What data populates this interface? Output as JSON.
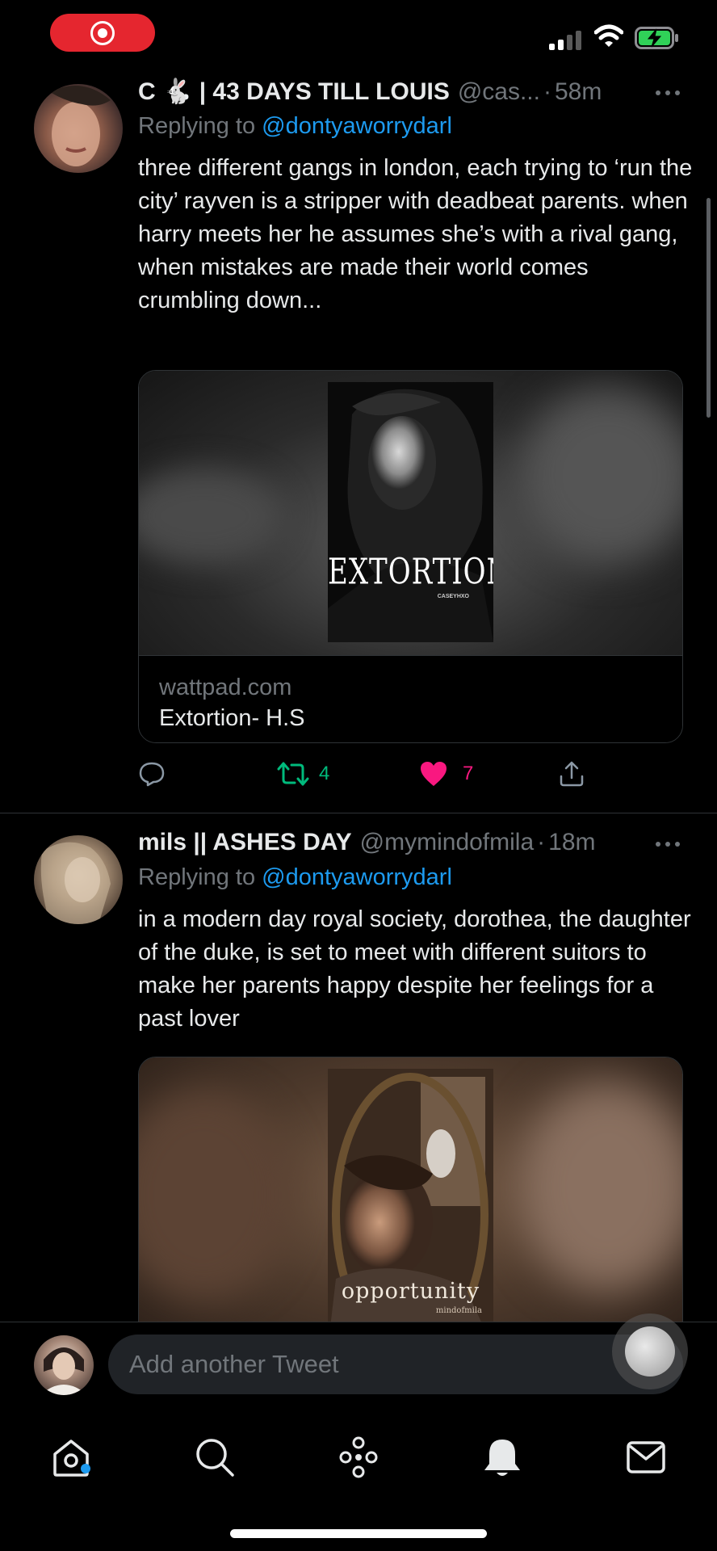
{
  "status_bar": {
    "recording_indicator": "screen-record-icon",
    "signal_icon": "cellular-signal-icon",
    "wifi_icon": "wifi-icon",
    "battery_icon": "battery-charging-icon",
    "battery_color": "#30d158",
    "record_color": "#e5262f"
  },
  "tweets": [
    {
      "display_name": "C 🐇 | 43 DAYS TILL LOUIS",
      "handle": "@cas...",
      "separator": "·",
      "time": "58m",
      "replying_prefix": "Replying to ",
      "replying_to": "@dontyaworrydarl",
      "text": "three different gangs in london, each trying to ‘run the city’ rayven is a stripper with deadbeat parents. when harry meets her he assumes she’s with a rival gang, when mistakes are made their world comes crumbling down...",
      "card": {
        "cover_title": "EXTORTION",
        "cover_author": "CASEYHXO",
        "domain": "wattpad.com",
        "title": "Extortion- H.S"
      },
      "actions": {
        "retweet_count": "4",
        "like_count": "7",
        "retweet_color": "#00ba7c",
        "like_color": "#f91880"
      }
    },
    {
      "display_name": "mils || ASHES DAY",
      "handle": "@mymindofmila",
      "separator": "·",
      "time": "18m",
      "replying_prefix": "Replying to ",
      "replying_to": "@dontyaworrydarl",
      "text": "in a modern day royal society, dorothea, the daughter of the duke, is set to meet with different suitors to make her parents happy despite her feelings for a past lover",
      "card": {
        "cover_title": "opportunity",
        "cover_author": "mindofmila"
      }
    }
  ],
  "compose": {
    "placeholder": "Add another Tweet"
  },
  "tabbar": {
    "items": [
      {
        "name": "home-icon"
      },
      {
        "name": "search-icon"
      },
      {
        "name": "spaces-icon"
      },
      {
        "name": "notifications-icon"
      },
      {
        "name": "messages-icon"
      }
    ]
  }
}
